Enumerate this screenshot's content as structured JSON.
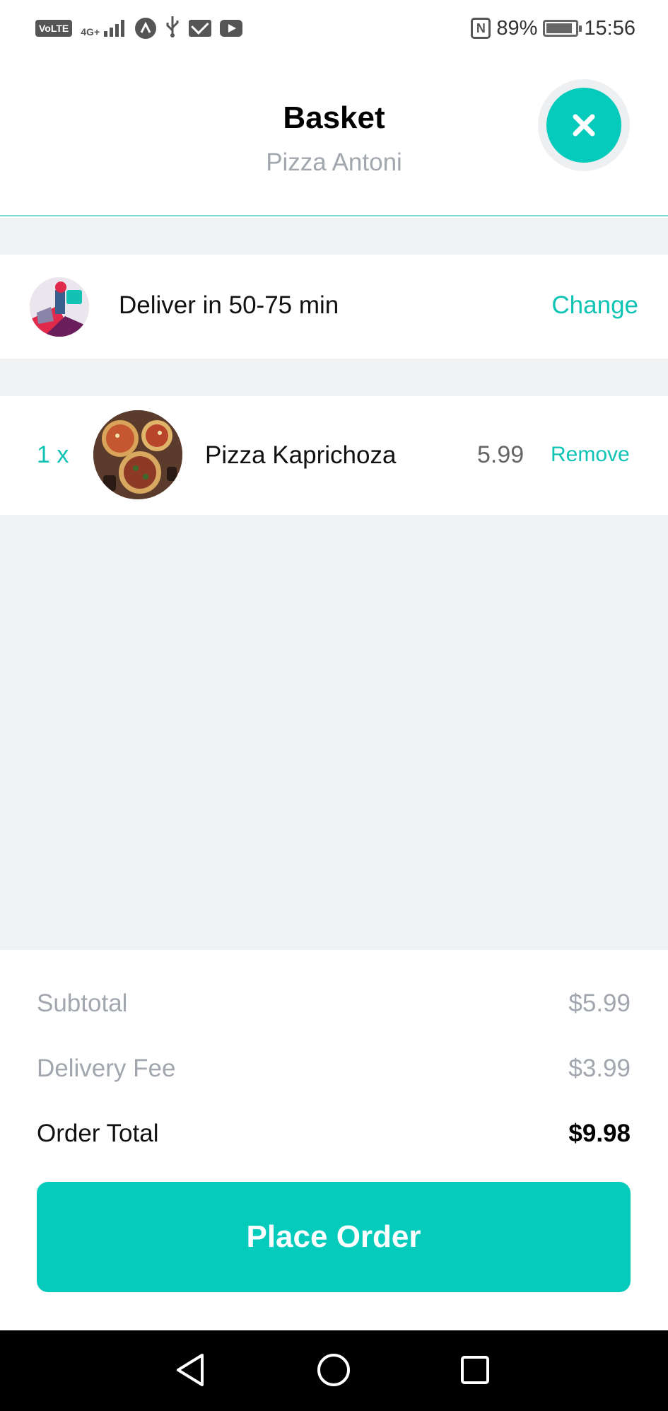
{
  "status_bar": {
    "network_badge": "VoLTE",
    "signal_label": "4G+",
    "battery_text": "89%",
    "battery_level": 0.89,
    "time": "15:56",
    "icons": [
      "volte-icon",
      "signal-icon",
      "app-icon",
      "usb-icon",
      "mail-icon",
      "youtube-icon",
      "nfc-icon",
      "battery-icon"
    ]
  },
  "header": {
    "title": "Basket",
    "restaurant": "Pizza Antoni",
    "close_icon": "close-icon"
  },
  "delivery": {
    "text": "Deliver in 50-75 min",
    "action": "Change"
  },
  "items": [
    {
      "quantity": "1 x",
      "name": "Pizza Kaprichoza",
      "price": "5.99",
      "action": "Remove"
    }
  ],
  "totals": {
    "subtotal_label": "Subtotal",
    "subtotal_value": "$5.99",
    "fee_label": "Delivery Fee",
    "fee_value": "$3.99",
    "total_label": "Order Total",
    "total_value": "$9.98"
  },
  "order_button": "Place Order",
  "nav": [
    "back-icon",
    "home-icon",
    "recents-icon"
  ],
  "colors": {
    "accent": "#04cbbb",
    "link": "#10c4b5",
    "muted": "#a2a6ae",
    "background": "#f1f2f4"
  }
}
